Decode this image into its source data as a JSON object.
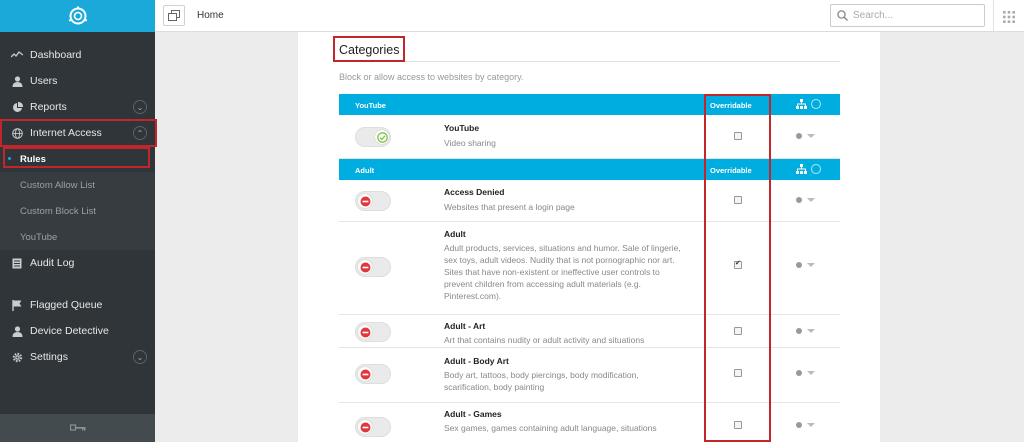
{
  "sidebar": {
    "items": [
      {
        "label": "Dashboard",
        "icon": "pulse-icon"
      },
      {
        "label": "Users",
        "icon": "user-icon"
      },
      {
        "label": "Reports",
        "icon": "pie-chart-icon"
      },
      {
        "label": "Internet Access",
        "icon": "globe-icon"
      }
    ],
    "sub_items": [
      "Rules",
      "Custom Allow List",
      "Custom Block List",
      "YouTube"
    ],
    "audit_log": "Audit Log",
    "lower_items": [
      {
        "label": "Flagged Queue",
        "icon": "flag-icon"
      },
      {
        "label": "Device Detective",
        "icon": "user-icon"
      },
      {
        "label": "Settings",
        "icon": "gear-icon"
      }
    ]
  },
  "topbar": {
    "breadcrumb": "Home",
    "search_placeholder": "Search..."
  },
  "categories": {
    "title": "Categories",
    "description": "Block or allow access to websites by category.",
    "overridable_label": "Overridable",
    "groups": [
      {
        "name": "YouTube",
        "rows": [
          {
            "title": "YouTube",
            "description": "Video sharing",
            "allowed": true,
            "overridable": false
          }
        ]
      },
      {
        "name": "Adult",
        "rows": [
          {
            "title": "Access Denied",
            "description": "Websites that present a login page",
            "allowed": false,
            "overridable": false
          },
          {
            "title": "Adult",
            "description": "Adult products, services, situations and humor. Sale of lingerie, sex toys, adult videos. Nudity that is not pornographic nor art. Sites that have non-existent or ineffective user controls to prevent children from accessing adult materials (e.g. Pinterest.com).",
            "allowed": false,
            "overridable": true
          },
          {
            "title": "Adult - Art",
            "description": "Art that contains nudity or adult activity and situations",
            "allowed": false,
            "overridable": false
          },
          {
            "title": "Adult - Body Art",
            "description": "Body art, tattoos, body piercings, body modification, scarification, body painting",
            "allowed": false,
            "overridable": false
          },
          {
            "title": "Adult - Games",
            "description": "Sex games, games containing adult language, situations",
            "allowed": false,
            "overridable": false
          }
        ]
      }
    ]
  },
  "colors": {
    "brand": "#1aa9d8",
    "sidebar_bg": "#2f3538",
    "header_bg": "#00ade0",
    "highlight": "#c0262c",
    "block": "#e0383e",
    "allow": "#7cc243"
  }
}
